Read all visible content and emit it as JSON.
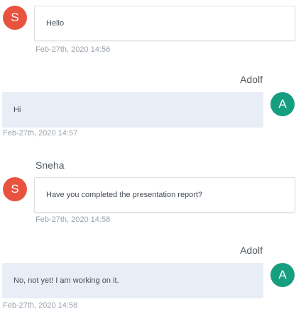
{
  "messages": [
    {
      "sender": "",
      "avatar": "S",
      "text": "Hello",
      "time": "Feb-27th, 2020 14:56"
    },
    {
      "sender": "Adolf",
      "avatar": "A",
      "text": "Hi",
      "time": "Feb-27th, 2020 14:57"
    },
    {
      "sender": "Sneha",
      "avatar": "S",
      "text": "Have you completed the presentation report?",
      "time": "Feb-27th, 2020 14:58"
    },
    {
      "sender": "Adolf",
      "avatar": "A",
      "text": "No, not yet! I am working on it.",
      "time": "Feb-27th, 2020 14:58"
    }
  ],
  "colors": {
    "avatar_s": "#e8533f",
    "avatar_a": "#169e80",
    "outgoing_bubble": "#e9eef6",
    "timestamp": "#9aa2ab"
  }
}
